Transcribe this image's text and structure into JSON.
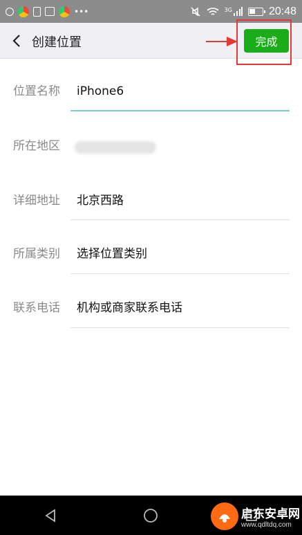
{
  "status_bar": {
    "time": "20:48",
    "network_badge": "3G"
  },
  "header": {
    "title": "创建位置",
    "done_label": "完成"
  },
  "form": {
    "rows": [
      {
        "label": "位置名称",
        "value": "iPhone6"
      },
      {
        "label": "所在地区",
        "value": ""
      },
      {
        "label": "详细地址",
        "value": "北京西路"
      },
      {
        "label": "所属类别",
        "value": "选择位置类别"
      },
      {
        "label": "联系电话",
        "value": "机构或商家联系电话"
      }
    ]
  },
  "watermark": {
    "title": "启东安卓网",
    "url": "www.qdltdq.com"
  },
  "colors": {
    "accent": "#1aad19",
    "annotation": "#e53935",
    "status_bar": "#8c8c8c",
    "header_bg": "#efeff4"
  },
  "icons": {
    "back": "chevron-left-icon",
    "nav_back": "triangle-back-icon",
    "nav_home": "circle-home-icon"
  }
}
